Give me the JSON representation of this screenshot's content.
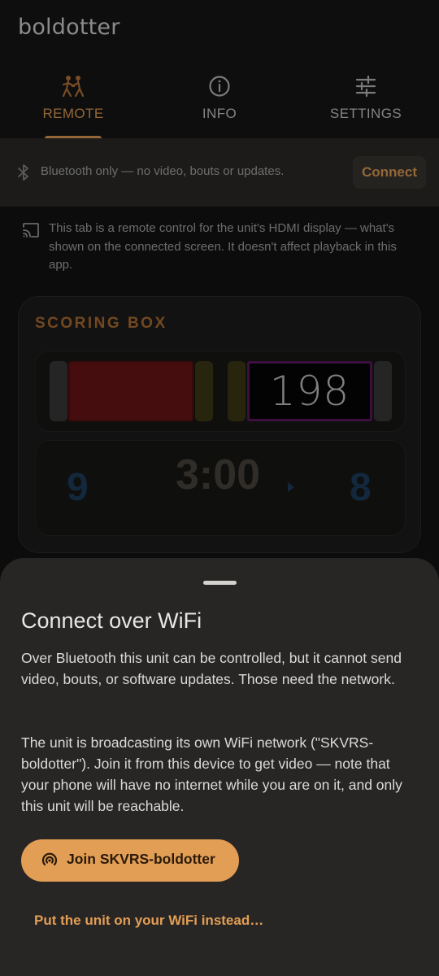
{
  "app": {
    "title": "boldotter"
  },
  "tabs": [
    {
      "label": "REMOTE",
      "icon": "fencing-icon",
      "active": true
    },
    {
      "label": "INFO",
      "icon": "info-icon",
      "active": false
    },
    {
      "label": "SETTINGS",
      "icon": "tune-icon",
      "active": false
    }
  ],
  "bluetooth_banner": {
    "icon": "bluetooth-icon",
    "text": "Bluetooth only — no video, bouts or updates.",
    "connect_label": "Connect"
  },
  "remote_note": {
    "icon": "cast-icon",
    "text": "This tab is a remote control for the unit's HDMI display — what's shown on the connected screen. It doesn't affect playback in this app."
  },
  "scoring_box": {
    "title": "SCORING BOX",
    "counter": "198",
    "score_left": "9",
    "score_right": "8",
    "timer": "3:00",
    "indicator_icon": "play-arrow-icon"
  },
  "sheet": {
    "title": "Connect over WiFi",
    "paragraph1": "Over Bluetooth this unit can be controlled, but it cannot send video, bouts, or software updates. Those need the network.",
    "paragraph2": "The unit is broadcasting its own WiFi network (\"SKVRS-boldotter\"). Join it from this device to get video — note that your phone will have no internet while you are on it, and only this unit will be reachable.",
    "join_label": "Join SKVRS-boldotter",
    "join_icon": "wifi-hotspot-icon",
    "alt_label": "Put the unit on your WiFi instead…"
  },
  "colors": {
    "accent": "#e29e55",
    "sheet_bg": "#282624",
    "red_lamp": "#6b1414",
    "score_blue": "#1e3e5c"
  }
}
